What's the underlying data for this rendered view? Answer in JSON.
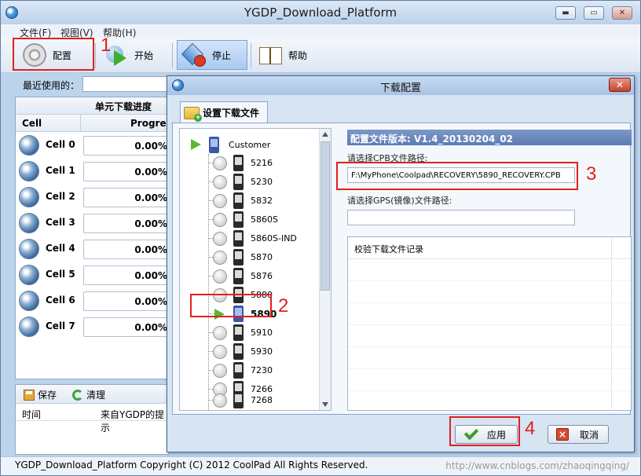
{
  "window": {
    "title": "YGDP_Download_Platform",
    "controls": {
      "minimize": "▬",
      "maximize": "▭",
      "close": "✕"
    }
  },
  "menu": [
    "文件(F)",
    "视图(V)",
    "帮助(H)"
  ],
  "toolbar": {
    "config": "配置",
    "start": "开始",
    "stop": "停止",
    "help": "帮助"
  },
  "recent": {
    "label": "最近使用的：",
    "value": ""
  },
  "cells": {
    "header": "单元下载进度",
    "col_cell": "Cell",
    "col_progress": "Progre",
    "rows": [
      {
        "name": "Cell 0",
        "progress": "0.00%"
      },
      {
        "name": "Cell 1",
        "progress": "0.00%"
      },
      {
        "name": "Cell 2",
        "progress": "0.00%"
      },
      {
        "name": "Cell 3",
        "progress": "0.00%"
      },
      {
        "name": "Cell 4",
        "progress": "0.00%"
      },
      {
        "name": "Cell 5",
        "progress": "0.00%"
      },
      {
        "name": "Cell 6",
        "progress": "0.00%"
      },
      {
        "name": "Cell 7",
        "progress": "0.00%"
      }
    ]
  },
  "log": {
    "save": "保存",
    "clean": "清理",
    "col_time": "时间",
    "col_source": "来自YGDP的提示"
  },
  "status": {
    "text": "YGDP_Download_Platform Copyright (C) 2012 CoolPad All Rights Reserved.",
    "watermark": "http://www.cnblogs.com/zhaoqingqing/"
  },
  "dialog": {
    "title": "下载配置",
    "close": "✕",
    "tab": "设置下载文件",
    "tree": {
      "root": "Customer",
      "items": [
        "5216",
        "5230",
        "5832",
        "5860S",
        "5860S-IND",
        "5870",
        "5876",
        "5880",
        "5890",
        "5910",
        "5930",
        "7230",
        "7266",
        "7268"
      ],
      "selected": "5890"
    },
    "version": "配置文件版本: V1.4_20130204_02",
    "cpb_label": "请选择CPB文件路径:",
    "cpb_value": "F:\\MyPhone\\Coolpad\\RECOVERY\\5890_RECOVERY.CPB",
    "gps_label": "请选择GPS(镜像)文件路径:",
    "gps_value": "",
    "log_header": "校验下载文件记录",
    "apply": "应用",
    "cancel": "取消"
  },
  "annotations": [
    "1",
    "2",
    "3",
    "4"
  ],
  "colors": {
    "annotation": "#e02020",
    "version_bar": "#6b88be"
  }
}
